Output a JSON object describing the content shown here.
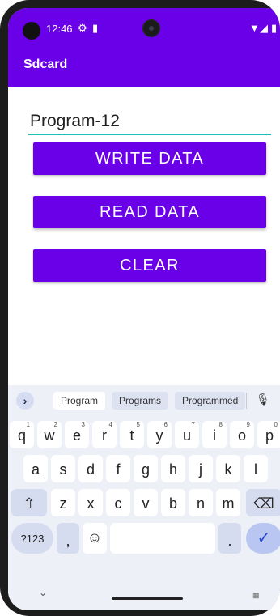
{
  "status_bar": {
    "time": "12:46",
    "icons": [
      "gear-icon",
      "sim-icon",
      "wifi-icon",
      "signal-icon",
      "battery-icon"
    ]
  },
  "app_bar": {
    "title": "Sdcard"
  },
  "editor": {
    "value": "Program-12"
  },
  "buttons": {
    "write": "WRITE DATA",
    "read": "READ DATA",
    "clear": "CLEAR"
  },
  "keyboard": {
    "suggestions": [
      "Program",
      "Programs",
      "Programmed"
    ],
    "row1": [
      "q",
      "w",
      "e",
      "r",
      "t",
      "y",
      "u",
      "i",
      "o",
      "p"
    ],
    "row1_hints": [
      "1",
      "2",
      "3",
      "4",
      "5",
      "6",
      "7",
      "8",
      "9",
      "0"
    ],
    "row2": [
      "a",
      "s",
      "d",
      "f",
      "g",
      "h",
      "j",
      "k",
      "l"
    ],
    "row3": [
      "z",
      "x",
      "c",
      "v",
      "b",
      "n",
      "m"
    ],
    "symbols_label": "?123",
    "comma_label": ",",
    "period_label": ".",
    "colors": {
      "accent": "#6a00e8",
      "underline": "#19c3b4",
      "keyboard_bg": "#eef0f8"
    }
  }
}
